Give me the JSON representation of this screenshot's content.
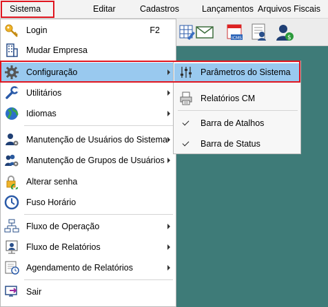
{
  "menubar": {
    "items": [
      {
        "label": "Sistema"
      },
      {
        "label": "Editar"
      },
      {
        "label": "Cadastros"
      },
      {
        "label": "Lançamentos"
      },
      {
        "label": "Arquivos Fiscais"
      }
    ]
  },
  "toolbar": {
    "icons": [
      "grid-edit-icon",
      "email-icon",
      "icms-calendar-icon",
      "user-document-icon",
      "user-money-icon"
    ]
  },
  "sistema_menu": {
    "items": [
      {
        "label": "Login",
        "shortcut": "F2",
        "icon": "key-icon"
      },
      {
        "label": "Mudar Empresa",
        "icon": "building-icon"
      },
      {
        "label": "Configuração",
        "icon": "gear-icon",
        "submenu": true,
        "highlighted": true
      },
      {
        "label": "Utilitários",
        "icon": "wrench-icon",
        "submenu": true
      },
      {
        "label": "Idiomas",
        "icon": "globe-icon",
        "submenu": true
      },
      {
        "label": "Manutenção de Usuários do Sistema",
        "icon": "user-gear-icon",
        "submenu": true
      },
      {
        "label": "Manutenção de Grupos de Usuários",
        "icon": "users-gear-icon",
        "submenu": true
      },
      {
        "label": "Alterar senha",
        "icon": "padlock-icon"
      },
      {
        "label": "Fuso Horário",
        "icon": "clock-icon"
      },
      {
        "label": "Fluxo de Operação",
        "icon": "flow-icon",
        "submenu": true
      },
      {
        "label": "Fluxo de Relatórios",
        "icon": "report-flow-icon",
        "submenu": true
      },
      {
        "label": "Agendamento de Relatórios",
        "icon": "schedule-icon",
        "submenu": true
      },
      {
        "label": "Sair",
        "icon": "exit-icon"
      }
    ]
  },
  "configuracao_submenu": {
    "items": [
      {
        "label": "Parâmetros do Sistema",
        "icon": "sliders-icon",
        "highlighted": true
      },
      {
        "label": "Relatórios CM",
        "icon": "printer-icon"
      },
      {
        "label": "Barra de Atalhos",
        "checked": true
      },
      {
        "label": "Barra de Status",
        "checked": true
      }
    ]
  },
  "colors": {
    "highlight": "#99c9ef",
    "annotation_red": "#e0141e",
    "app_background": "#3e7b78"
  }
}
